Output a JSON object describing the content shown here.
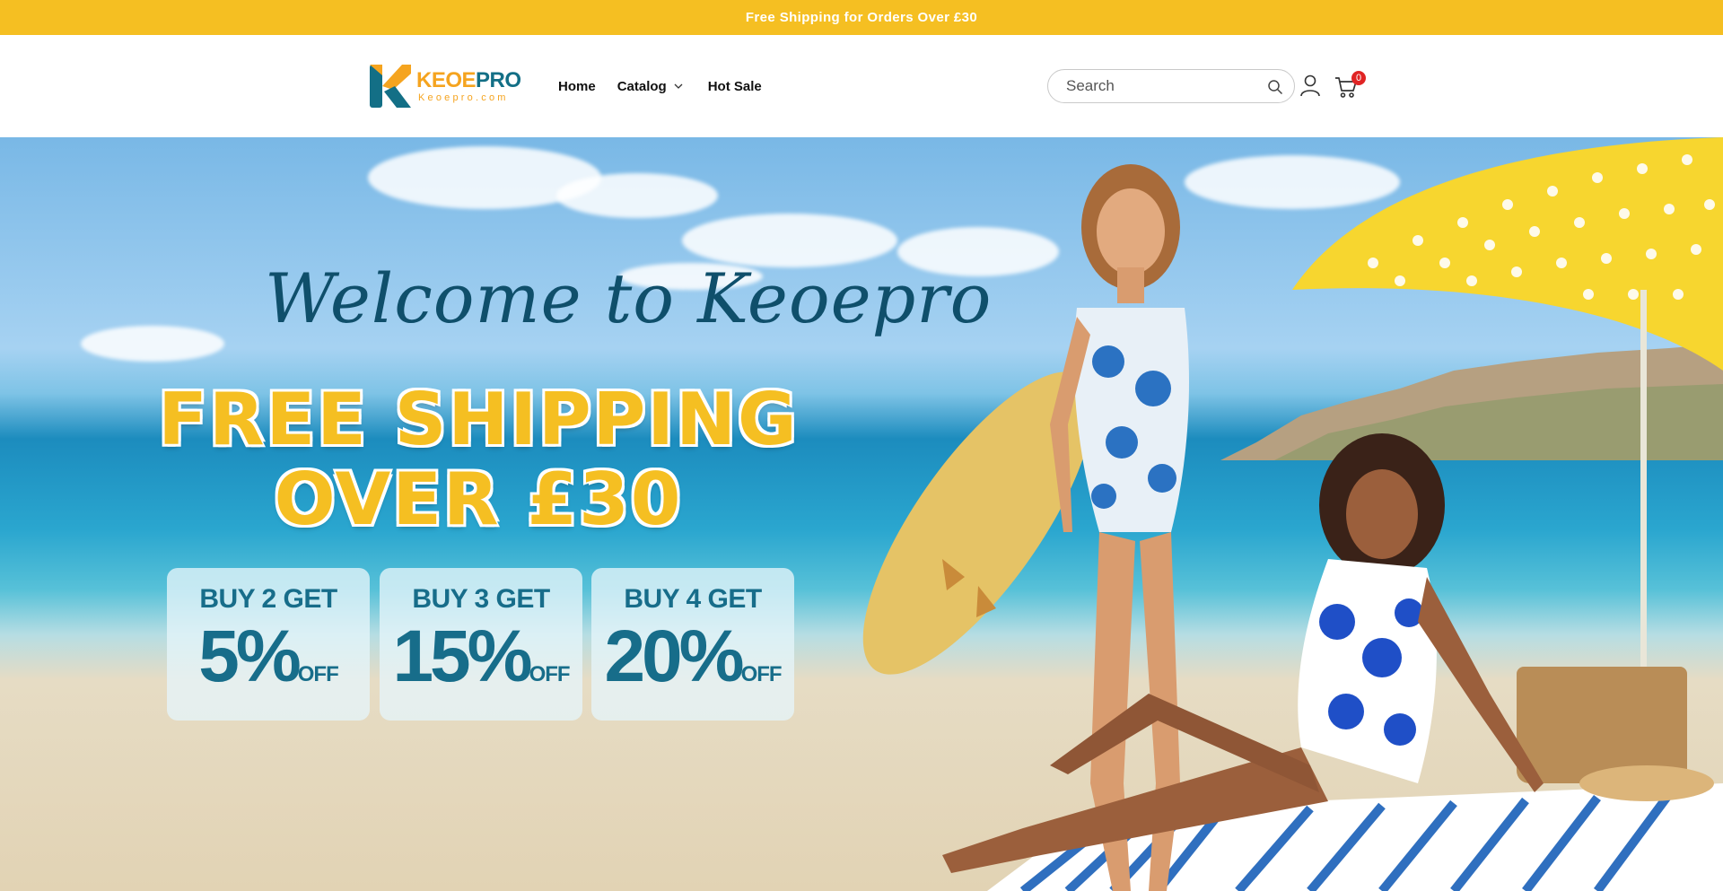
{
  "announcement": {
    "text": "Free Shipping for Orders Over £30"
  },
  "header": {
    "logo": {
      "brand_part1": "KEOE",
      "brand_part2": "PRO",
      "subtitle": "Keoepro.com"
    },
    "nav": [
      {
        "label": "Home",
        "glyph": ""
      },
      {
        "label": "Catalog",
        "has_dropdown": true
      },
      {
        "label": "Hot Sale",
        "glyph": ""
      }
    ],
    "search": {
      "placeholder": "Search"
    },
    "cart": {
      "count": "0"
    }
  },
  "hero": {
    "welcome": "Welcome to Keoepro",
    "headline_line1": "FREE SHIPPING",
    "headline_line2": "OVER £30",
    "offers": [
      {
        "buy": "BUY 2 GET",
        "percent": "5%",
        "off": "OFF"
      },
      {
        "buy": "BUY 3 GET",
        "percent": "15%",
        "off": "OFF"
      },
      {
        "buy": "BUY 4 GET",
        "percent": "20%",
        "off": "OFF"
      }
    ]
  },
  "colors": {
    "accent": "#f5bf22",
    "brand_teal": "#136f86",
    "brand_orange": "#f5a41f",
    "badge": "#e02424"
  },
  "icons": [
    "search-icon",
    "account-icon",
    "cart-icon",
    "chevron-down-icon"
  ]
}
